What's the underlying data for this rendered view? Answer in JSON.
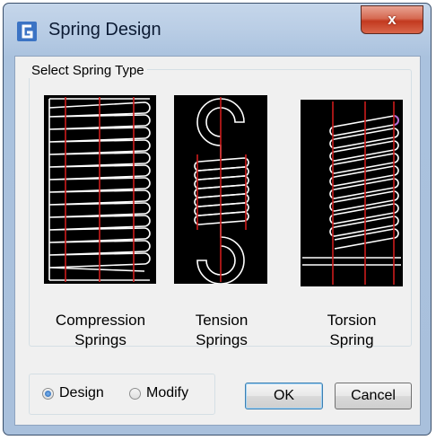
{
  "window": {
    "title": "Spring Design",
    "close_symbol": "x",
    "accent": "#c2391f"
  },
  "group": {
    "label": "Select Spring Type",
    "types": [
      {
        "caption_line1": "Compression",
        "caption_line2": "Springs"
      },
      {
        "caption_line1": "Tension",
        "caption_line2": "Springs"
      },
      {
        "caption_line1": "Torsion",
        "caption_line2": "Spring"
      }
    ]
  },
  "mode": {
    "options": [
      {
        "label": "Design",
        "selected": true
      },
      {
        "label": "Modify",
        "selected": false
      }
    ]
  },
  "buttons": {
    "ok": "OK",
    "cancel": "Cancel"
  },
  "colors": {
    "centerline": "#cc1b1b",
    "coil": "#ffffff",
    "preview_bg": "#000000"
  }
}
